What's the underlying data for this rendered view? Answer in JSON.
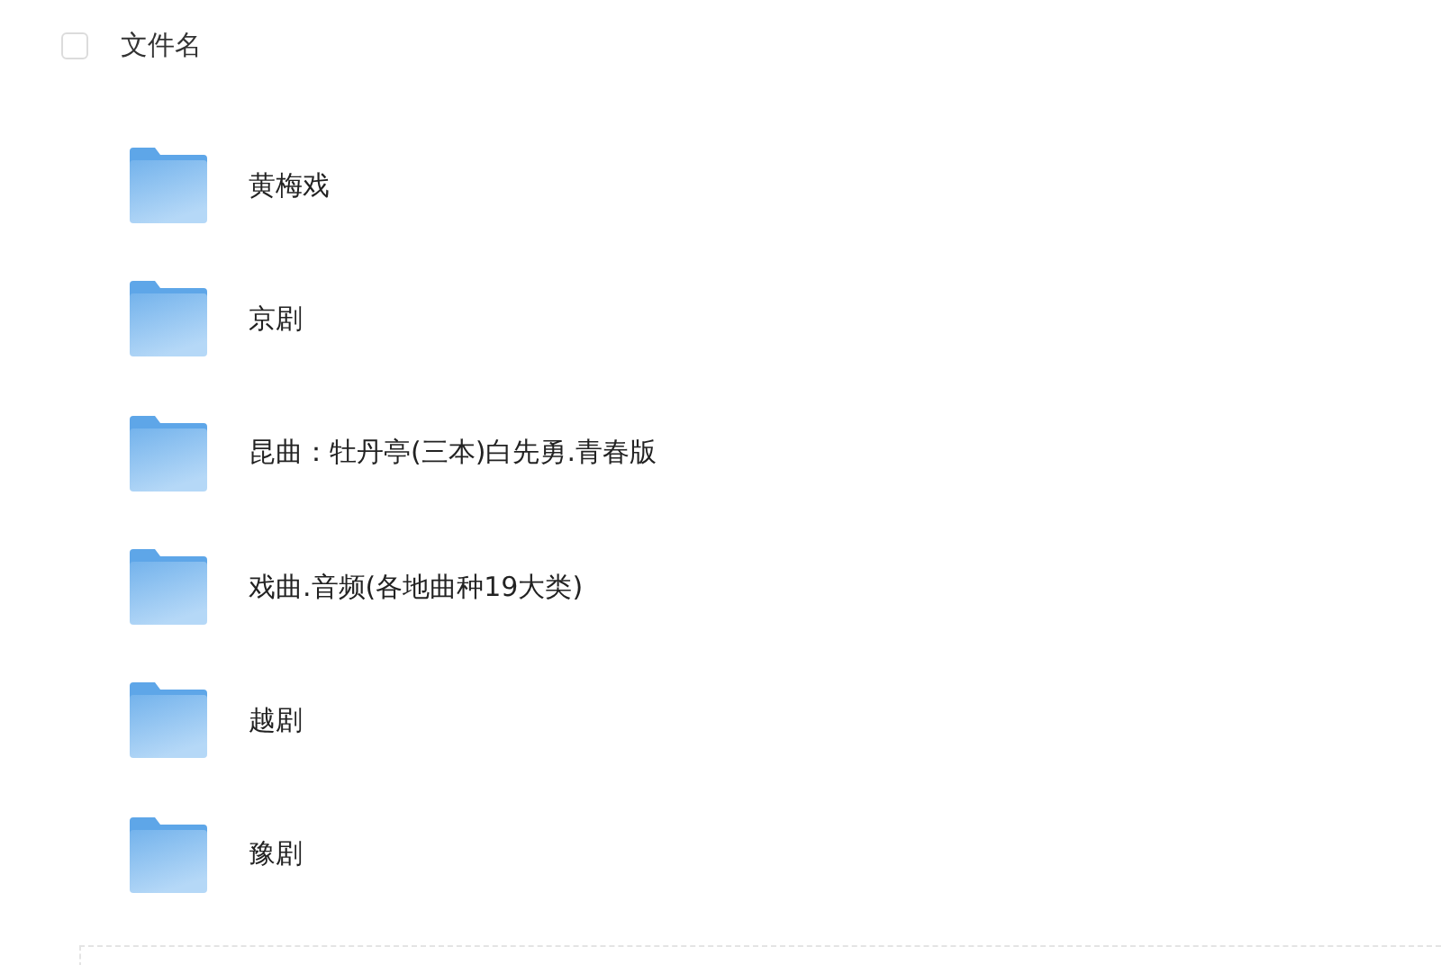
{
  "header": {
    "label": "文件名",
    "checked": false
  },
  "folders": [
    {
      "name": "黄梅戏"
    },
    {
      "name": "京剧"
    },
    {
      "name": "昆曲：牡丹亭(三本)白先勇.青春版"
    },
    {
      "name": "戏曲.音频(各地曲种19大类)"
    },
    {
      "name": "越剧"
    },
    {
      "name": "豫剧"
    }
  ]
}
